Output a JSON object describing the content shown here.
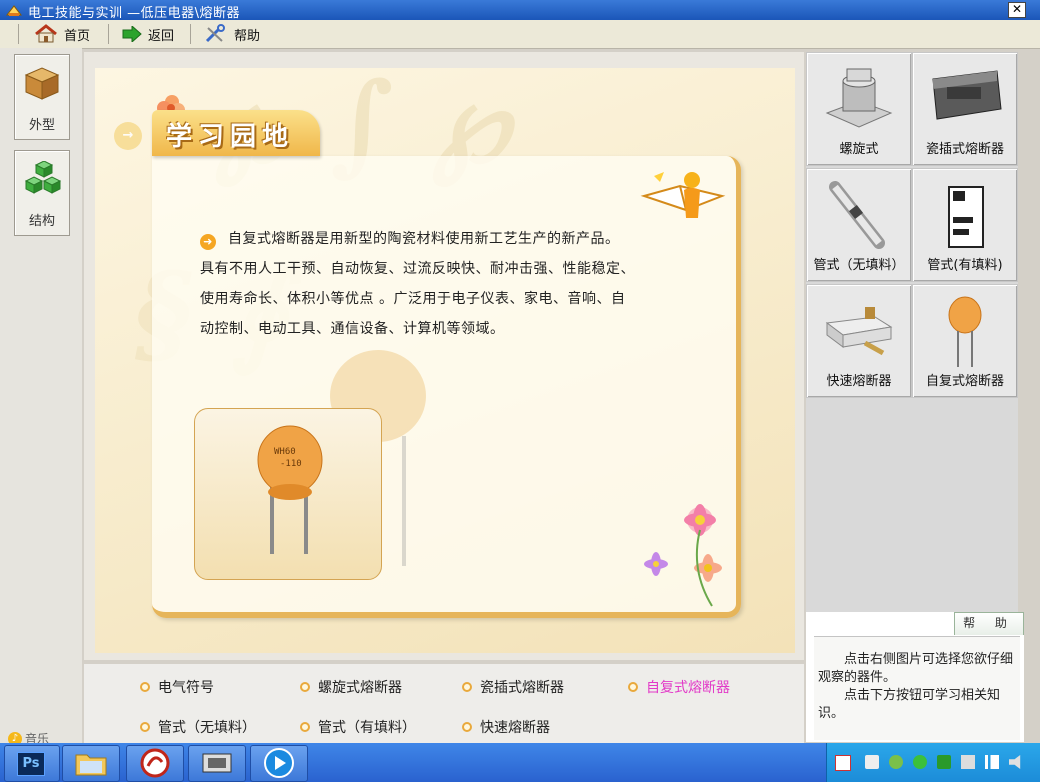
{
  "window": {
    "title": "电工技能与实训 —低压电器\\熔断器",
    "close_label": "✕"
  },
  "toolbar": {
    "home_label": "首页",
    "back_label": "返回",
    "help_label": "帮助"
  },
  "sidebar": {
    "items": [
      {
        "label": "外型",
        "icon": "box-icon"
      },
      {
        "label": "结构",
        "icon": "cubes-icon"
      }
    ],
    "music_label": "音乐"
  },
  "main": {
    "heading": "学习园地",
    "paragraph": "自复式熔断器是用新型的陶瓷材料使用新工艺生产的新产品。具有不用人工干预、自动恢复、过流反映快、耐冲击强、性能稳定、使用寿命长、体积小等优点 。广泛用于电子仪表、家电、音响、自动控制、电动工具、通信设备、计算机等领域。",
    "paragraph_lines": [
      "自复式熔断器是用新型的陶瓷材料使用新工艺生产的新产品。",
      "具有不用人工干预、自动恢复、过流反映快、耐冲击强、性能稳定、",
      "使用寿命长、体积小等优点 。广泛用于电子仪表、家电、音响、自",
      "动控制、电动工具、通信设备、计算机等领域。"
    ],
    "component_marking_1": "WH60",
    "component_marking_2": "-110"
  },
  "thumbnails": [
    {
      "label": "螺旋式",
      "icon": "screw-fuse-icon"
    },
    {
      "label": "瓷插式熔断器",
      "icon": "porcelain-plug-fuse-icon"
    },
    {
      "label": "管式（无填料）",
      "icon": "tube-fuse-unfilled-icon"
    },
    {
      "label": "管式(有填料)",
      "icon": "tube-fuse-filled-icon"
    },
    {
      "label": "快速熔断器",
      "icon": "fast-fuse-icon"
    },
    {
      "label": "自复式熔断器",
      "icon": "self-reset-fuse-icon"
    }
  ],
  "help": {
    "tab_label": "帮 助",
    "line1": "点击右侧图片可选择您欲仔细观察的器件。",
    "line2": "点击下方按钮可学习相关知识。"
  },
  "bottom_nav": {
    "items": [
      {
        "label": "电气符号",
        "active": false
      },
      {
        "label": "螺旋式熔断器",
        "active": false
      },
      {
        "label": "瓷插式熔断器",
        "active": false
      },
      {
        "label": "自复式熔断器",
        "active": true
      },
      {
        "label": "管式（无填料）",
        "active": false
      },
      {
        "label": "管式（有填料）",
        "active": false
      },
      {
        "label": "快速熔断器",
        "active": false
      }
    ],
    "active_color": "#e23ac8"
  },
  "taskbar": {
    "ps_label": "Ps"
  }
}
